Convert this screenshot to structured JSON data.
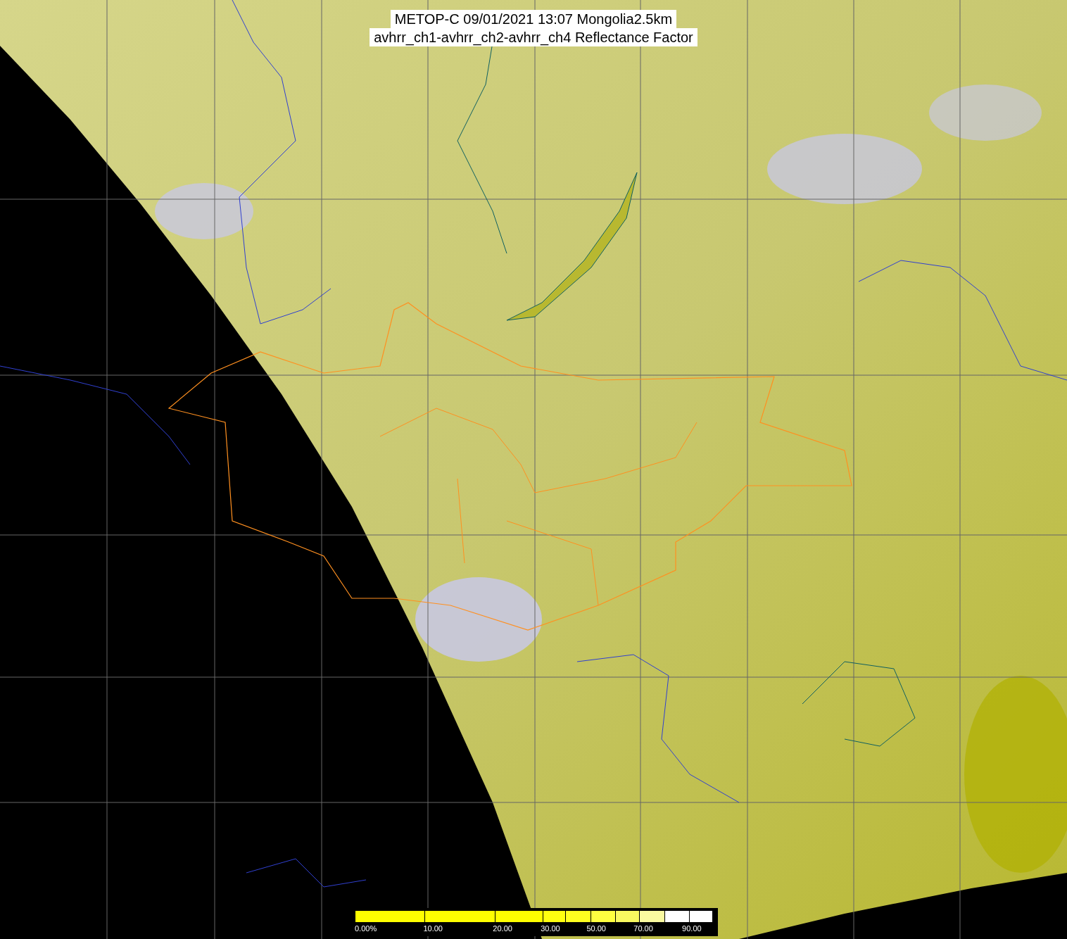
{
  "title": {
    "lines": [
      "METOP-C 09/01/2021 13:07 Mongolia2.5km",
      "avhrr_ch1-avhrr_ch2-avhrr_ch4 Reflectance Factor"
    ]
  },
  "colorbar": {
    "segments": [
      {
        "color": "#ffff00"
      },
      {
        "color": "#ffff00"
      },
      {
        "color": "#ffff00"
      },
      {
        "color": "#ffff10"
      },
      {
        "color": "#ffff20"
      },
      {
        "color": "#ffff40"
      },
      {
        "color": "#f8f860"
      },
      {
        "color": "#fafaa0"
      },
      {
        "color": "#ffffff"
      },
      {
        "color": "#ffffff"
      }
    ],
    "ticks": [
      "0.00%",
      "10.00",
      "20.00",
      "30.00",
      "50.00",
      "70.00",
      "90.00"
    ]
  }
}
